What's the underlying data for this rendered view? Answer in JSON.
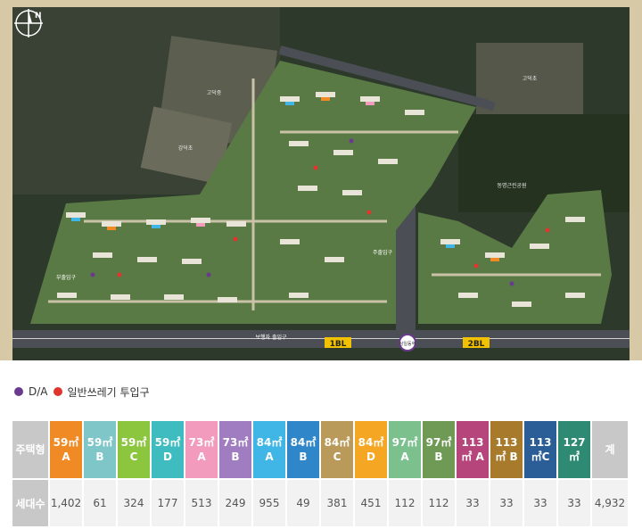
{
  "map": {
    "labels": {
      "school_top": "고덕중",
      "school_mid": "강덕초",
      "school_right": "고덕초",
      "park": "동명근린공원",
      "block1": "1BL",
      "block2": "2BL",
      "main_gate": "주출입구",
      "sub_gate": "부출입구",
      "ped_gate": "보행자 출입구",
      "stop": "상일동역"
    },
    "colors": {
      "red_marker": "#e0352f",
      "purple_marker": "#6a3a8f",
      "road": "#4b4f55",
      "block_tag": "#f2c200"
    }
  },
  "compass": {
    "letter": "N"
  },
  "legend": {
    "items": [
      {
        "label": "D/A",
        "color": "#6a3a8f"
      },
      {
        "label": "일반쓰레기 투입구",
        "color": "#e0352f"
      }
    ]
  },
  "table": {
    "row_label_type": "주택형",
    "row_label_count": "세대수",
    "total_label": "계",
    "columns": [
      {
        "type": "59㎡A",
        "count": "1,402",
        "color": "#f08a24"
      },
      {
        "type": "59㎡B",
        "count": "61",
        "color": "#7fc6c8"
      },
      {
        "type": "59㎡C",
        "count": "324",
        "color": "#8cc63f"
      },
      {
        "type": "59㎡D",
        "count": "177",
        "color": "#3fbcbf"
      },
      {
        "type": "73㎡A",
        "count": "513",
        "color": "#f29bbd"
      },
      {
        "type": "73㎡B",
        "count": "249",
        "color": "#a07cc0"
      },
      {
        "type": "84㎡A",
        "count": "955",
        "color": "#3fb6e5"
      },
      {
        "type": "84㎡B",
        "count": "49",
        "color": "#2f86c8"
      },
      {
        "type": "84㎡C",
        "count": "381",
        "color": "#b99a5a"
      },
      {
        "type": "84㎡D",
        "count": "451",
        "color": "#f5a623"
      },
      {
        "type": "97㎡A",
        "count": "112",
        "color": "#7cc08e"
      },
      {
        "type": "97㎡B",
        "count": "112",
        "color": "#6f9a55"
      },
      {
        "type": "113㎡ A",
        "count": "33",
        "color": "#b5457a"
      },
      {
        "type": "113㎡ B",
        "count": "33",
        "color": "#a87a2b"
      },
      {
        "type": "113㎡C",
        "count": "33",
        "color": "#2b5e96"
      },
      {
        "type": "127㎡",
        "count": "33",
        "color": "#2f8a73"
      }
    ],
    "total": "4,932"
  }
}
